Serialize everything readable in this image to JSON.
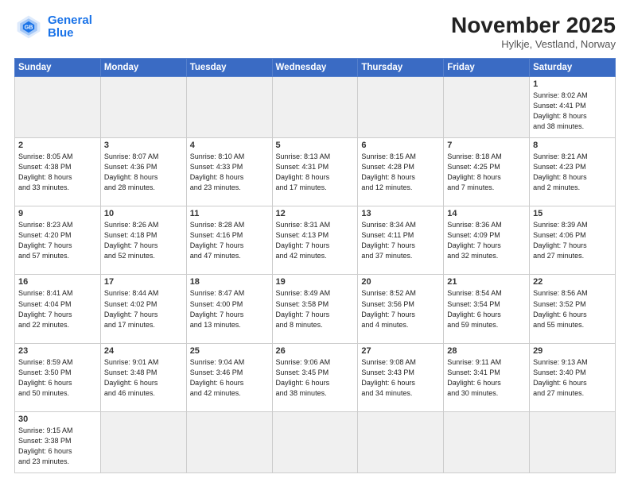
{
  "logo": {
    "line1": "General",
    "line2": "Blue"
  },
  "title": "November 2025",
  "subtitle": "Hylkje, Vestland, Norway",
  "weekdays": [
    "Sunday",
    "Monday",
    "Tuesday",
    "Wednesday",
    "Thursday",
    "Friday",
    "Saturday"
  ],
  "weeks": [
    [
      {
        "day": "",
        "info": "",
        "empty": true
      },
      {
        "day": "",
        "info": "",
        "empty": true
      },
      {
        "day": "",
        "info": "",
        "empty": true
      },
      {
        "day": "",
        "info": "",
        "empty": true
      },
      {
        "day": "",
        "info": "",
        "empty": true
      },
      {
        "day": "",
        "info": "",
        "empty": true
      },
      {
        "day": "1",
        "info": "Sunrise: 8:02 AM\nSunset: 4:41 PM\nDaylight: 8 hours\nand 38 minutes."
      }
    ],
    [
      {
        "day": "2",
        "info": "Sunrise: 8:05 AM\nSunset: 4:38 PM\nDaylight: 8 hours\nand 33 minutes."
      },
      {
        "day": "3",
        "info": "Sunrise: 8:07 AM\nSunset: 4:36 PM\nDaylight: 8 hours\nand 28 minutes."
      },
      {
        "day": "4",
        "info": "Sunrise: 8:10 AM\nSunset: 4:33 PM\nDaylight: 8 hours\nand 23 minutes."
      },
      {
        "day": "5",
        "info": "Sunrise: 8:13 AM\nSunset: 4:31 PM\nDaylight: 8 hours\nand 17 minutes."
      },
      {
        "day": "6",
        "info": "Sunrise: 8:15 AM\nSunset: 4:28 PM\nDaylight: 8 hours\nand 12 minutes."
      },
      {
        "day": "7",
        "info": "Sunrise: 8:18 AM\nSunset: 4:25 PM\nDaylight: 8 hours\nand 7 minutes."
      },
      {
        "day": "8",
        "info": "Sunrise: 8:21 AM\nSunset: 4:23 PM\nDaylight: 8 hours\nand 2 minutes."
      }
    ],
    [
      {
        "day": "9",
        "info": "Sunrise: 8:23 AM\nSunset: 4:20 PM\nDaylight: 7 hours\nand 57 minutes."
      },
      {
        "day": "10",
        "info": "Sunrise: 8:26 AM\nSunset: 4:18 PM\nDaylight: 7 hours\nand 52 minutes."
      },
      {
        "day": "11",
        "info": "Sunrise: 8:28 AM\nSunset: 4:16 PM\nDaylight: 7 hours\nand 47 minutes."
      },
      {
        "day": "12",
        "info": "Sunrise: 8:31 AM\nSunset: 4:13 PM\nDaylight: 7 hours\nand 42 minutes."
      },
      {
        "day": "13",
        "info": "Sunrise: 8:34 AM\nSunset: 4:11 PM\nDaylight: 7 hours\nand 37 minutes."
      },
      {
        "day": "14",
        "info": "Sunrise: 8:36 AM\nSunset: 4:09 PM\nDaylight: 7 hours\nand 32 minutes."
      },
      {
        "day": "15",
        "info": "Sunrise: 8:39 AM\nSunset: 4:06 PM\nDaylight: 7 hours\nand 27 minutes."
      }
    ],
    [
      {
        "day": "16",
        "info": "Sunrise: 8:41 AM\nSunset: 4:04 PM\nDaylight: 7 hours\nand 22 minutes."
      },
      {
        "day": "17",
        "info": "Sunrise: 8:44 AM\nSunset: 4:02 PM\nDaylight: 7 hours\nand 17 minutes."
      },
      {
        "day": "18",
        "info": "Sunrise: 8:47 AM\nSunset: 4:00 PM\nDaylight: 7 hours\nand 13 minutes."
      },
      {
        "day": "19",
        "info": "Sunrise: 8:49 AM\nSunset: 3:58 PM\nDaylight: 7 hours\nand 8 minutes."
      },
      {
        "day": "20",
        "info": "Sunrise: 8:52 AM\nSunset: 3:56 PM\nDaylight: 7 hours\nand 4 minutes."
      },
      {
        "day": "21",
        "info": "Sunrise: 8:54 AM\nSunset: 3:54 PM\nDaylight: 6 hours\nand 59 minutes."
      },
      {
        "day": "22",
        "info": "Sunrise: 8:56 AM\nSunset: 3:52 PM\nDaylight: 6 hours\nand 55 minutes."
      }
    ],
    [
      {
        "day": "23",
        "info": "Sunrise: 8:59 AM\nSunset: 3:50 PM\nDaylight: 6 hours\nand 50 minutes."
      },
      {
        "day": "24",
        "info": "Sunrise: 9:01 AM\nSunset: 3:48 PM\nDaylight: 6 hours\nand 46 minutes."
      },
      {
        "day": "25",
        "info": "Sunrise: 9:04 AM\nSunset: 3:46 PM\nDaylight: 6 hours\nand 42 minutes."
      },
      {
        "day": "26",
        "info": "Sunrise: 9:06 AM\nSunset: 3:45 PM\nDaylight: 6 hours\nand 38 minutes."
      },
      {
        "day": "27",
        "info": "Sunrise: 9:08 AM\nSunset: 3:43 PM\nDaylight: 6 hours\nand 34 minutes."
      },
      {
        "day": "28",
        "info": "Sunrise: 9:11 AM\nSunset: 3:41 PM\nDaylight: 6 hours\nand 30 minutes."
      },
      {
        "day": "29",
        "info": "Sunrise: 9:13 AM\nSunset: 3:40 PM\nDaylight: 6 hours\nand 27 minutes."
      }
    ],
    [
      {
        "day": "30",
        "info": "Sunrise: 9:15 AM\nSunset: 3:38 PM\nDaylight: 6 hours\nand 23 minutes.",
        "active": true
      },
      {
        "day": "",
        "info": "",
        "empty": true
      },
      {
        "day": "",
        "info": "",
        "empty": true
      },
      {
        "day": "",
        "info": "",
        "empty": true
      },
      {
        "day": "",
        "info": "",
        "empty": true
      },
      {
        "day": "",
        "info": "",
        "empty": true
      },
      {
        "day": "",
        "info": "",
        "empty": true
      }
    ]
  ]
}
